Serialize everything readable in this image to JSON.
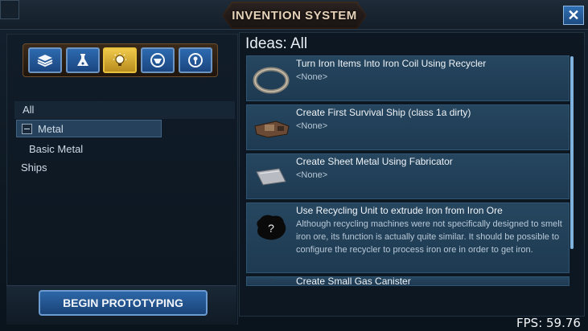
{
  "window": {
    "title": "INVENTION SYSTEM",
    "close_label": "✕"
  },
  "categories": [
    {
      "name": "all-category",
      "icon": "stack-icon",
      "active": false
    },
    {
      "name": "flask-category",
      "icon": "flask-icon",
      "active": false
    },
    {
      "name": "ideas-category",
      "icon": "lightbulb-icon",
      "active": true
    },
    {
      "name": "ships-category",
      "icon": "ship-icon",
      "active": false
    },
    {
      "name": "locks-category",
      "icon": "keyhole-icon",
      "active": false
    }
  ],
  "tree": {
    "all": "All",
    "metal": "Metal",
    "basic_metal": "Basic Metal",
    "ships": "Ships"
  },
  "prototype_button": "BEGIN PROTOTYPING",
  "ideas_header": "Ideas: All",
  "ideas": [
    {
      "title": "Turn Iron Items Into Iron Coil Using Recycler",
      "sub": "<None>",
      "thumb": "iron-coil-icon"
    },
    {
      "title": "Create First Survival Ship (class 1a dirty)",
      "sub": "<None>",
      "thumb": "survival-ship-icon"
    },
    {
      "title": "Create Sheet Metal Using Fabricator",
      "sub": "<None>",
      "thumb": "sheet-metal-icon"
    },
    {
      "title": "Use Recycling Unit to extrude Iron from Iron Ore",
      "sub": "Although recycling machines were not specifically designed to smelt iron ore, its function is actually quite similar. It should be possible to configure the recycler to process iron ore in order to get iron.",
      "thumb": "unknown-idea-icon"
    },
    {
      "title": "Create Small Gas Canister",
      "sub": "",
      "thumb": "gas-canister-icon"
    }
  ],
  "fps": "FPS: 59.76",
  "colors": {
    "accent_blue": "#2d67a8",
    "active_gold": "#e8c23c",
    "title_plate": "#3a2a1e"
  }
}
